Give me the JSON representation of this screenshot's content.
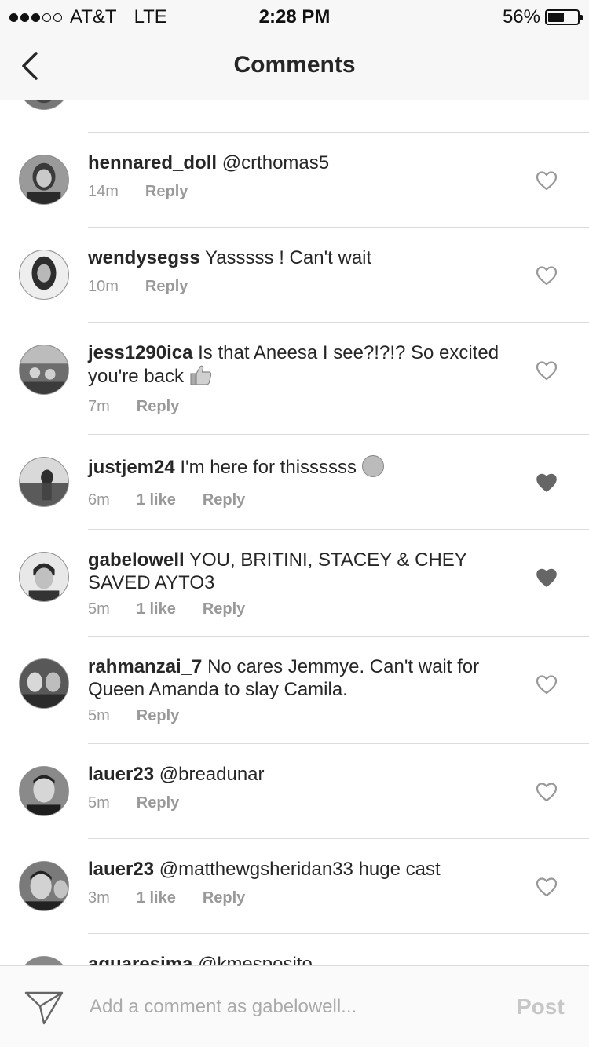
{
  "status_bar": {
    "carrier": "AT&T",
    "network": "LTE",
    "time": "2:28 PM",
    "battery": "56%",
    "battery_level": 0.56,
    "signal_bars_filled": 3,
    "signal_bars_total": 5
  },
  "nav": {
    "title": "Comments",
    "back_icon": "chevron-left-icon"
  },
  "reply_label": "Reply",
  "comments": [
    {
      "user": "hennared_doll",
      "text": "@crthomas5",
      "time": "14m",
      "likes": "",
      "liked": false
    },
    {
      "user": "wendysegss",
      "text": "Yasssss ! Can't wait",
      "time": "10m",
      "likes": "",
      "liked": false
    },
    {
      "user": "jess1290ica",
      "text": "Is that Aneesa I see?!?!? So excited you're back",
      "emoji": "thumbs-up",
      "time": "7m",
      "likes": "",
      "liked": false
    },
    {
      "user": "justjem24",
      "text": "I'm here for thissssss",
      "emoji": "upside-down-face",
      "time": "6m",
      "likes": "1 like",
      "liked": true
    },
    {
      "user": "gabelowell",
      "text": "YOU, BRITINI, STACEY & CHEY SAVED AYTO3",
      "time": "5m",
      "likes": "1 like",
      "liked": true
    },
    {
      "user": "rahmanzai_7",
      "text": "No cares Jemmye. Can't wait for Queen Amanda to slay Camila.",
      "time": "5m",
      "likes": "",
      "liked": false
    },
    {
      "user": "lauer23",
      "text": "@breadunar",
      "time": "5m",
      "likes": "",
      "liked": false
    },
    {
      "user": "lauer23",
      "text": "@matthewgsheridan33 huge cast",
      "time": "3m",
      "likes": "1 like",
      "liked": false
    },
    {
      "user": "aquaresima",
      "text": "@kmesposito"
    }
  ],
  "composer": {
    "placeholder": "Add a comment as gabelowell...",
    "post_label": "Post",
    "send_icon": "paper-plane-icon"
  }
}
